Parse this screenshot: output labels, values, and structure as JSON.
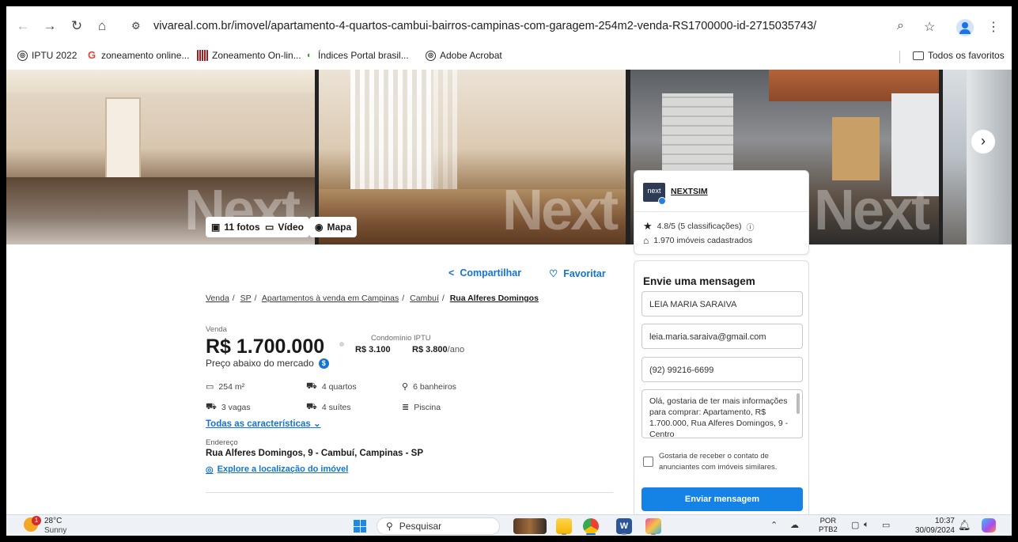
{
  "browser": {
    "url": "vivareal.com.br/imovel/apartamento-4-quartos-cambui-bairros-campinas-com-garagem-254m2-venda-RS1700000-id-2715035743/"
  },
  "bookmarks": {
    "items": [
      {
        "label": "IPTU 2022",
        "icon": "globe-icon"
      },
      {
        "label": "zoneamento online...",
        "icon": "google-icon"
      },
      {
        "label": "Zoneamento On-lin...",
        "icon": "campinas-icon"
      },
      {
        "label": "Índices Portal brasil...",
        "icon": "portal-icon"
      },
      {
        "label": "Adobe Acrobat",
        "icon": "globe-icon"
      }
    ],
    "all_favorites": "Todos os favoritos"
  },
  "gallery": {
    "photos_btn": "11 fotos",
    "video_btn": "Vídeo",
    "map_btn": "Mapa",
    "watermark": "Next"
  },
  "actions": {
    "share": "Compartilhar",
    "favorite": "Favoritar"
  },
  "breadcrumb": {
    "items": [
      "Venda",
      "SP",
      "Apartamentos à venda em Campinas",
      "Cambuí"
    ],
    "current": "Rua Alferes Domingos"
  },
  "listing": {
    "sale_label": "Venda",
    "price": "R$ 1.700.000",
    "condo_label": "Condomínio",
    "condo_value": "R$ 3.100",
    "iptu_label": "IPTU",
    "iptu_value": "R$ 3.800",
    "iptu_suffix": "/ano",
    "below_market": "Preço abaixo do mercado",
    "features": {
      "area": "254 m²",
      "bedrooms": "4 quartos",
      "bathrooms": "6 banheiros",
      "parking": "3 vagas",
      "suites": "4 suítes",
      "pool": "Piscina"
    },
    "all_features": "Todas as características",
    "address_label": "Endereço",
    "address": "Rua Alferes Domingos, 9 - Cambuí, Campinas - SP",
    "explore": "Explore a localização do imóvel"
  },
  "agency": {
    "logo_text": "next",
    "name": "NEXTSIM",
    "rating": "4.8/5 (5 classificações)",
    "listings": "1.970 imóveis cadastrados"
  },
  "message_form": {
    "title": "Envie uma mensagem",
    "name_value": "LEIA MARIA SARAIVA",
    "email_value": "leia.maria.saraiva@gmail.com",
    "phone_value": "(92) 99216-6699",
    "message_value": "Olá, gostaria de ter mais informações para comprar: Apartamento, R$ 1.700.000, Rua Alferes Domingos, 9 - Centro",
    "checkbox_label": "Gostaria de receber o contato de anunciantes com imóveis similares.",
    "submit": "Enviar mensagem"
  },
  "taskbar": {
    "temp": "28°C",
    "weather": "Sunny",
    "weather_badge": "1",
    "search_placeholder": "Pesquisar",
    "lang_1": "POR",
    "lang_2": "PTB2",
    "time": "10:37",
    "date": "30/09/2024"
  },
  "colors": {
    "accent": "#1483e5",
    "link": "#1374d3"
  }
}
